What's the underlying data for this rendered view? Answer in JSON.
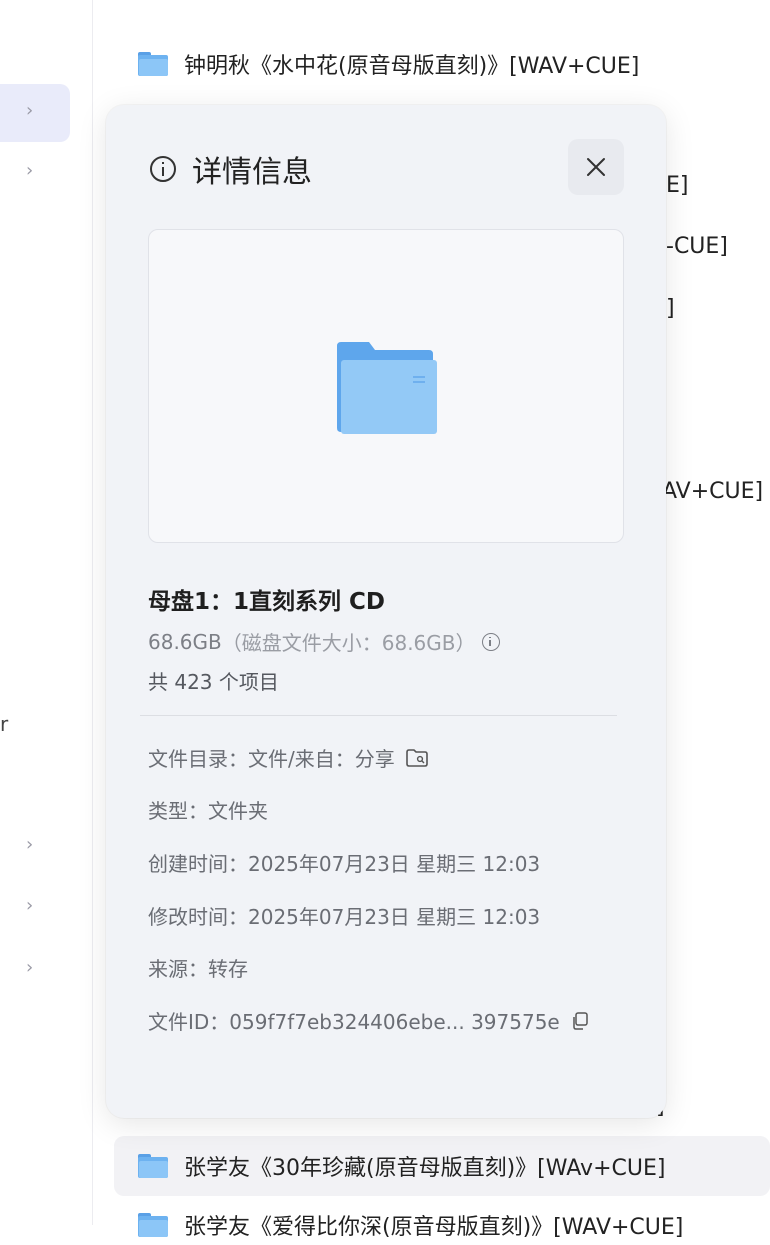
{
  "sidebar": {
    "truncated_label": "r"
  },
  "file_list": {
    "rows": [
      {
        "name": "钟明秋《水中花(原音母版直刻)》[WAV+CUE]"
      },
      {
        "name": "张学友《30年珍藏(原音母版直刻)》[WAv+CUE]"
      },
      {
        "name": "张学友《爱得比你深(原音母版直刻)》[WAV+CUE]"
      }
    ],
    "peek_texts": [
      "]",
      "E]",
      "-CUE]",
      "]",
      "AV+CUE]",
      "]"
    ]
  },
  "panel": {
    "title": "详情信息",
    "name": "母盘1：1直刻系列 CD",
    "size": "68.6GB",
    "disk_size": "（磁盘文件大小：68.6GB）",
    "count": "共 423 个项目",
    "directory": "文件目录：文件/来自：分享",
    "type": "类型：文件夹",
    "created": "创建时间：2025年07月23日 星期三 12:03",
    "modified": "修改时间：2025年07月23日 星期三 12:03",
    "source": "来源：转存",
    "file_id": "文件ID：059f7f7eb324406ebe... 397575e"
  },
  "colors": {
    "panel_bg": "#f1f3f7",
    "folder_blue": "#6db2f0",
    "active_nav": "#e9ebfa"
  }
}
